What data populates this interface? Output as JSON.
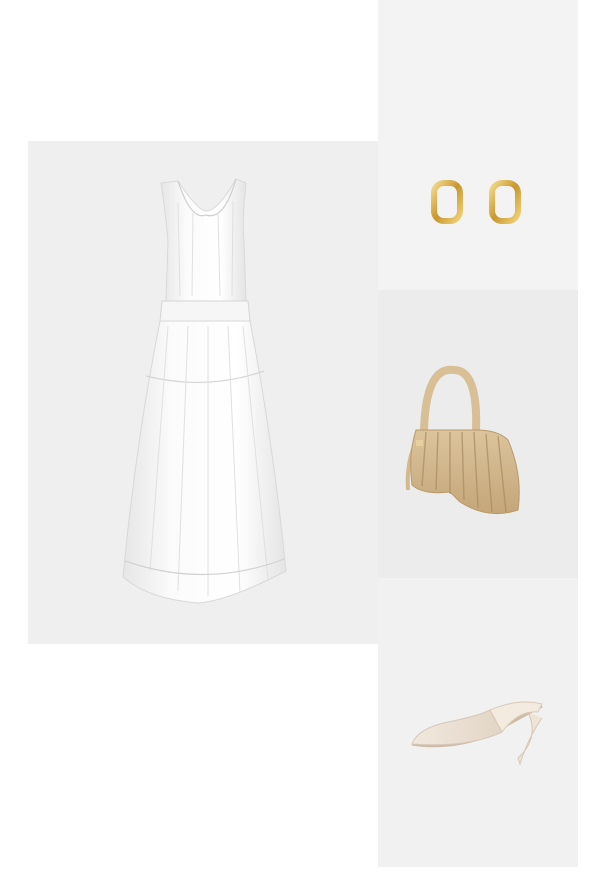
{
  "outfit": {
    "items": [
      {
        "product": "dress",
        "icon": "white-midi-dress",
        "color": "#ffffff",
        "background": "#efefef"
      },
      {
        "product": "earrings",
        "icon": "gold-hoop-earrings",
        "color": "#d8b04a",
        "background": "#f3f3f3"
      },
      {
        "product": "handbag",
        "icon": "beige-pleated-shoulder-bag",
        "color": "#cfb48a",
        "background": "#ececec"
      },
      {
        "product": "shoes",
        "icon": "cream-mesh-mule-heels",
        "color": "#eadfd2",
        "background": "#f1f1f1"
      }
    ]
  }
}
